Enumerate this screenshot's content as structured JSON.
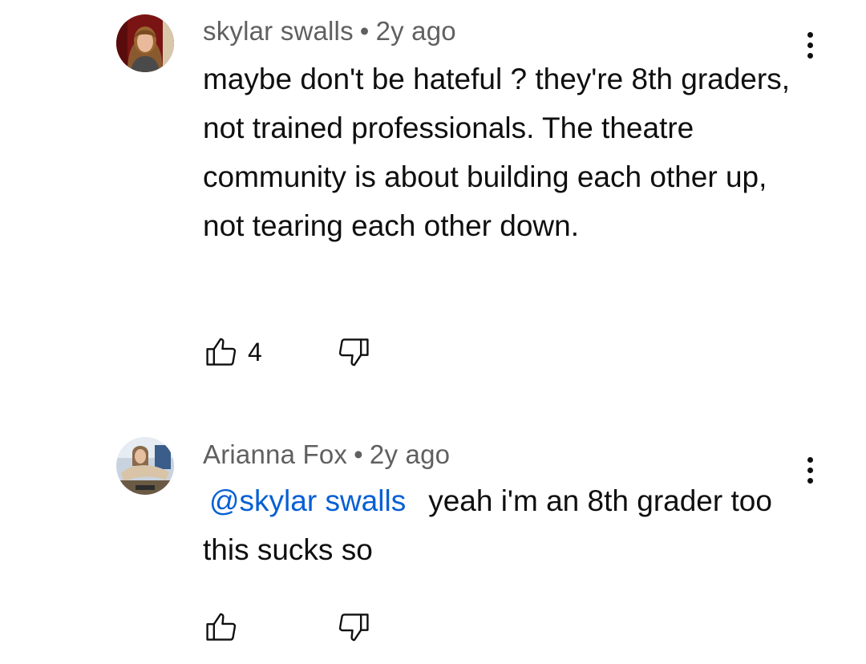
{
  "comments": [
    {
      "author": "skylar swalls",
      "time": "2y ago",
      "separator": "•",
      "text": "maybe don't be hateful ? they're 8th graders, not trained professionals. The theatre community is about building each other up, not tearing each other down.",
      "likes": "4"
    },
    {
      "author": "Arianna Fox",
      "time": "2y ago",
      "separator": "•",
      "mention": "@skylar swalls",
      "text": "yeah i'm an 8th grader too this sucks so",
      "likes": ""
    }
  ],
  "colors": {
    "meta": "#606060",
    "text": "#0f0f0f",
    "mention": "#065fd4"
  },
  "icons": {
    "like": "thumb-up-outline-icon",
    "dislike": "thumb-down-outline-icon",
    "more": "vertical-ellipsis-icon"
  }
}
